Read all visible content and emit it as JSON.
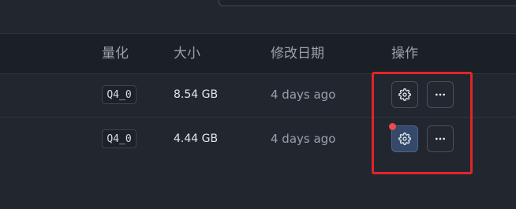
{
  "table": {
    "headers": {
      "quantization": "量化",
      "size": "大小",
      "modified": "修改日期",
      "actions": "操作"
    },
    "rows": [
      {
        "quantization": "Q4_0",
        "size": "8.54 GB",
        "modified": "4 days ago"
      },
      {
        "quantization": "Q4_0",
        "size": "4.44 GB",
        "modified": "4 days ago"
      }
    ]
  },
  "icons": {
    "settings": "gear-icon",
    "more": "more-horizontal-icon"
  },
  "colors": {
    "background": "#22262e",
    "header_background": "#1b1f26",
    "active_button": "#35496a",
    "highlight": "#e0262a",
    "notification_dot": "#ef4b4b"
  }
}
